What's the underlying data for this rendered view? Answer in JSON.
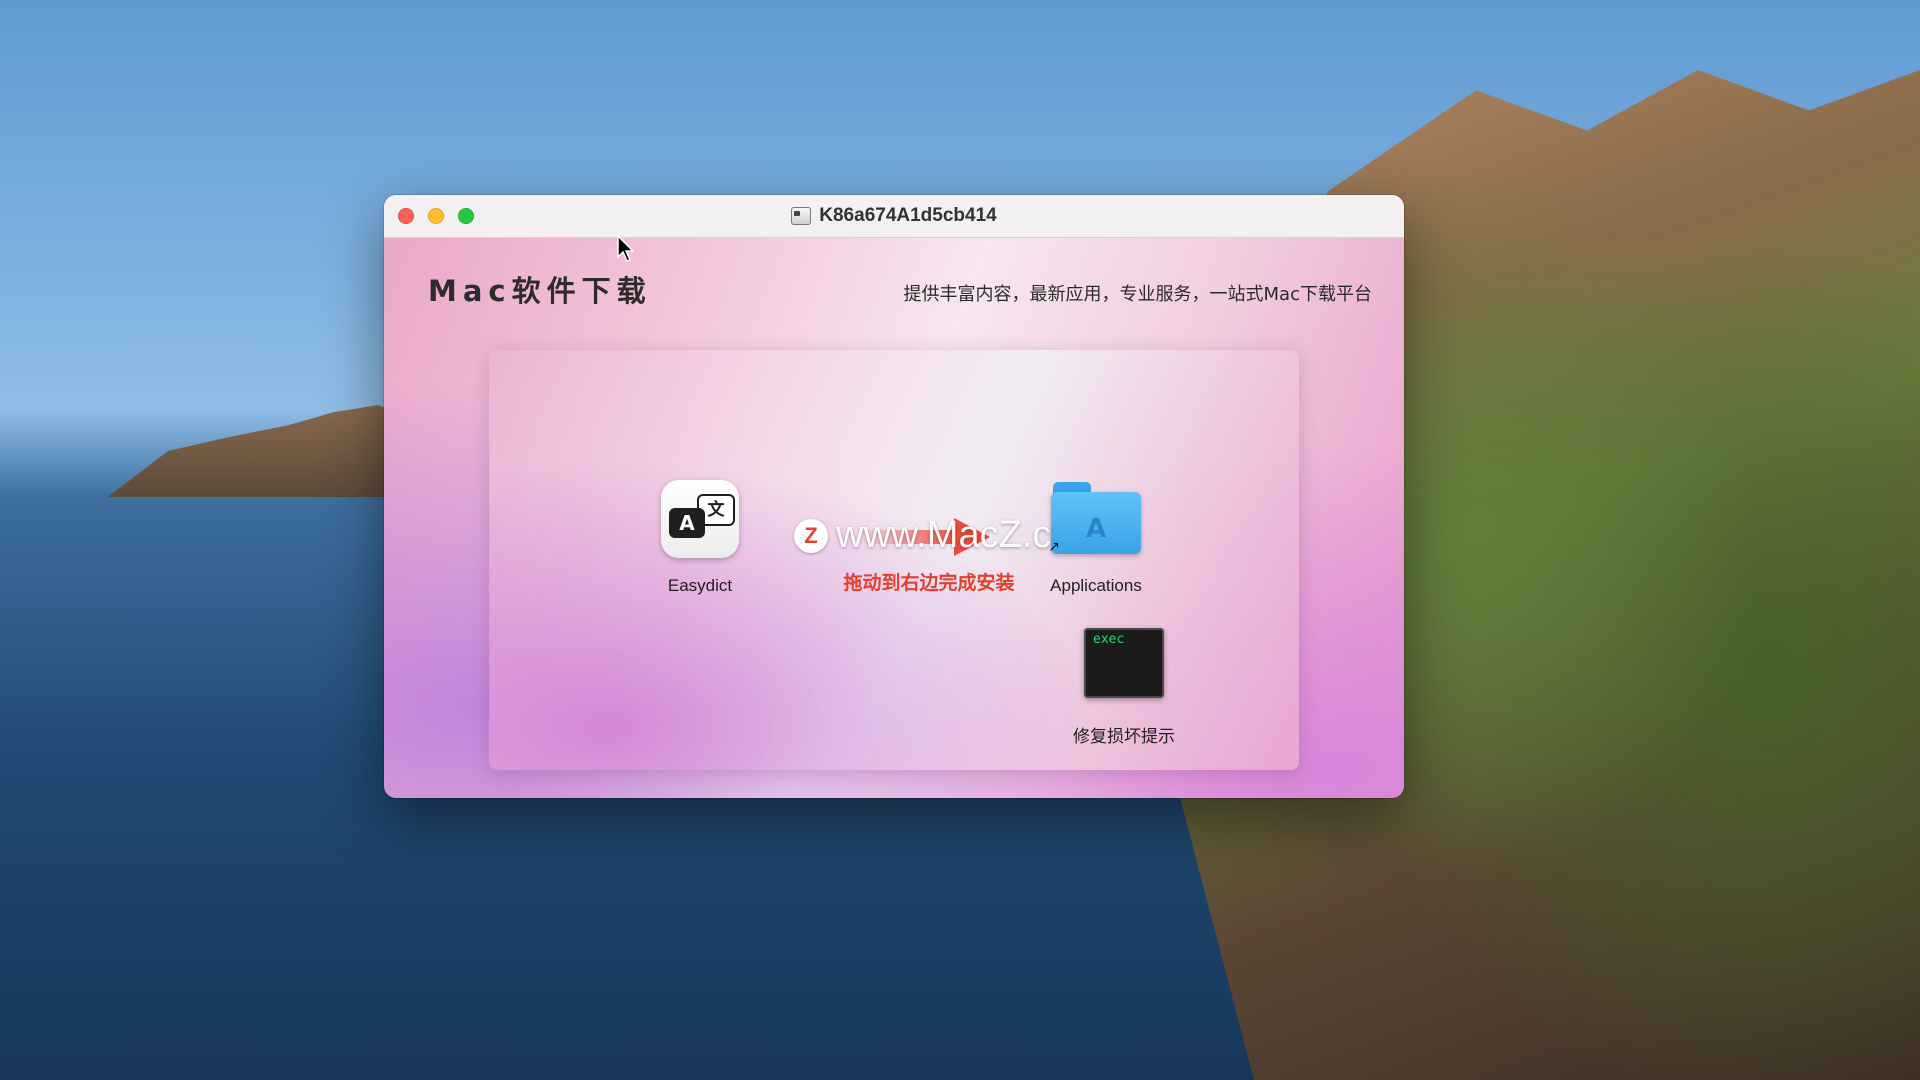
{
  "window": {
    "title": "K86a674A1d5cb414"
  },
  "header": {
    "brand_title": "Mac软件下载",
    "slogan": "提供丰富内容，最新应用，专业服务，一站式Mac下载平台"
  },
  "installer": {
    "app_name": "Easydict",
    "target_name": "Applications",
    "instruction": "拖动到右边完成安装",
    "watermark": "www.MacZ.com",
    "watermark_logo": "Z",
    "repair_tool_label": "修复损坏提示",
    "repair_tool_icon_text": "exec"
  },
  "icons": {
    "easydict_glyph_a": "A",
    "easydict_glyph_b": "文",
    "folder_glyph": "A"
  },
  "colors": {
    "close": "#ff5f57",
    "minimize": "#febc2e",
    "maximize": "#28c840",
    "hint_red": "#e0402e"
  }
}
